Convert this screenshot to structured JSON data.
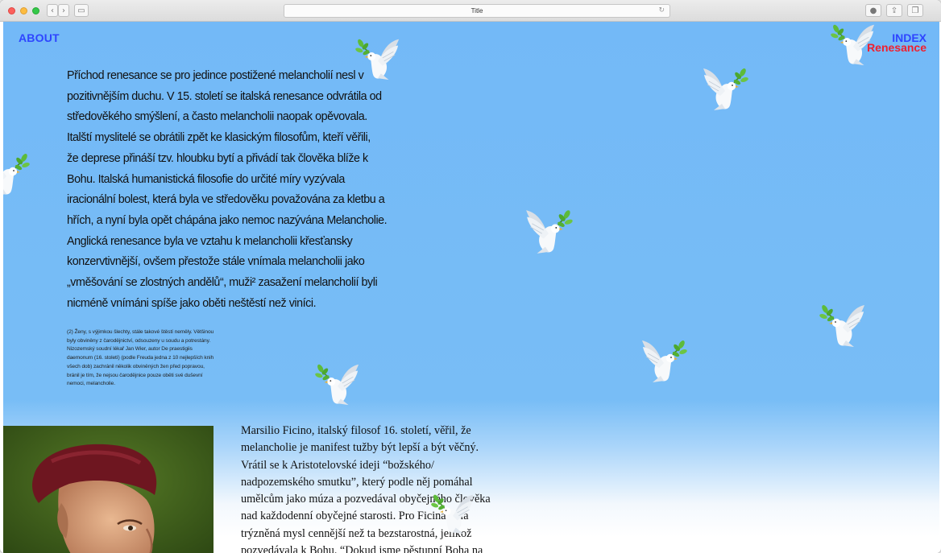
{
  "browser": {
    "title": "Title",
    "back_icon": "chevron-left-icon",
    "forward_icon": "chevron-right-icon",
    "sidebar_icon": "sidebar-icon",
    "reload_icon": "reload-icon",
    "toolbar_icons": [
      "download-icon",
      "share-icon",
      "tabs-icon"
    ]
  },
  "nav": {
    "about": "ABOUT",
    "index": "INDEX",
    "section": "Renesance"
  },
  "content": {
    "main_lines": [
      "Příchod renesance se pro jedince postižené melancholií nesl v",
      "pozitivnějším duchu. V 15. století se italská renesance odvrátila od",
      "středověkého smýšlení, a často melancholii naopak opěvovala.",
      "Italští myslitelé  se obrátili zpět ke klasickým filosofům, kteří věřili,",
      "že deprese přináší tzv. hloubku bytí a přivádí tak člověka blíže k",
      "Bohu. Italská humanistická filosofie do určité míry vyzývala",
      "iracionální bolest, která byla ve středověku považována za kletbu a",
      "hřích, a nyní byla opět chápána jako nemoc nazývána Melancholie.",
      "Anglická renesance byla ve vztahu k melancholii křesťansky",
      "konzervtivnější, ovšem přestože stále vnímala melancholii jako",
      "„vměšování se zlostných andělů“, muži² zasažení melancholií byli",
      "nicméně vnímáni spíše jako oběti neštěstí než viníci."
    ],
    "footnote_lines": [
      "(2) Ženy, s výjimkou šlechty, stále takové štěstí neměly. Většinou",
      "byly obviněny z čarodějnictví, odsouzeny u soudu a potrestány.",
      "Nizozemský soudní lékař Jan Wier, autor De praestigiis",
      "daemonum (16. století) (podle Freuda jedna z 10 nejlepších knih",
      "všech dob) zachránil několik obviněných žen před popravou,",
      "bránil je tím, že nejsou čarodějnice pouze oběti své duševní",
      "nemoci, melancholie."
    ],
    "serif_lines": [
      "Marsilio Ficino, italský filosof 16. století, věřil, že",
      "melancholie je manifest tužby být lepší a být věčný.",
      "Vrátil se k Aristotelovské ideji “božského/",
      "nadpozemského smutku”, který podle něj pomáhal",
      "umělcům jako múza a pozvedával obyčejného člověka",
      "nad každodenní obyčejné starosti. Pro Ficina byla",
      "trýzněná mysl cennější než ta bezstarostná, jelikož",
      "pozvedávala k Bohu. “Dokud jsme pěstupní Boha na"
    ]
  },
  "decor": {
    "dove_icon": "dove-with-olive-branch-icon",
    "portrait": "portrait-painting",
    "colors": {
      "sky": "#78bdf6",
      "nav_blue": "#2e45ff",
      "nav_red": "#f0202e"
    }
  }
}
